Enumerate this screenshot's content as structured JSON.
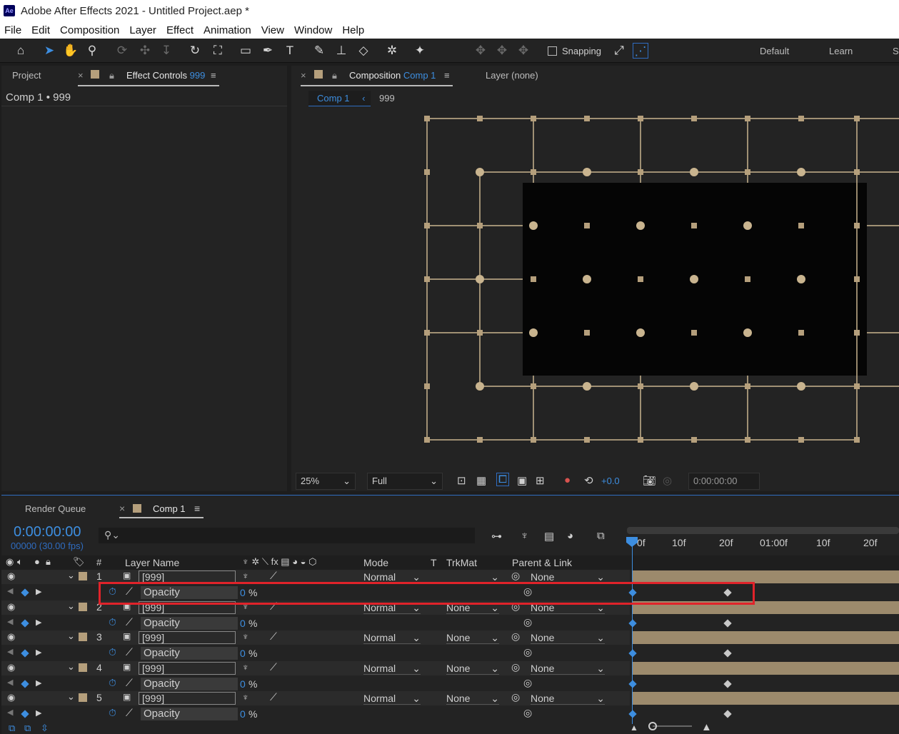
{
  "window": {
    "title": "Adobe After Effects 2021 - Untitled Project.aep *",
    "logo": "Ae"
  },
  "menu": [
    "File",
    "Edit",
    "Composition",
    "Layer",
    "Effect",
    "Animation",
    "View",
    "Window",
    "Help"
  ],
  "toolbar": {
    "snapping_label": "Snapping",
    "workspaces": [
      "Default",
      "Learn",
      "St"
    ]
  },
  "left_panel": {
    "tab_project": "Project",
    "tab_effect_controls": "Effect Controls",
    "effect_controls_target": "999",
    "breadcrumb": "Comp 1 • 999"
  },
  "comp_panel": {
    "tab_label": "Composition",
    "tab_comp_name": "Comp 1",
    "layer_tab": "Layer (none)",
    "nav_current": "Comp 1",
    "nav_child": "999",
    "zoom": "25%",
    "resolution": "Full",
    "exposure": "+0.0",
    "timecode": "0:00:00:00"
  },
  "timeline": {
    "tab_render_queue": "Render Queue",
    "tab_comp": "Comp 1",
    "current_time": "0:00:00:00",
    "frame_info": "00000 (30.00 fps)",
    "columns": {
      "num": "#",
      "layer_name": "Layer Name",
      "mode": "Mode",
      "t": "T",
      "trkmat": "TrkMat",
      "parent": "Parent & Link"
    },
    "ruler": [
      "0f",
      "10f",
      "20f",
      "01:00f",
      "10f",
      "20f"
    ],
    "layers": [
      {
        "num": "1",
        "name": "[999]",
        "mode": "Normal",
        "trkmat": "",
        "parent": "None",
        "prop": "Opacity",
        "prop_value": "0",
        "unit": "%"
      },
      {
        "num": "2",
        "name": "[999]",
        "mode": "Normal",
        "trkmat": "None",
        "parent": "None",
        "prop": "Opacity",
        "prop_value": "0",
        "unit": "%"
      },
      {
        "num": "3",
        "name": "[999]",
        "mode": "Normal",
        "trkmat": "None",
        "parent": "None",
        "prop": "Opacity",
        "prop_value": "0",
        "unit": "%"
      },
      {
        "num": "4",
        "name": "[999]",
        "mode": "Normal",
        "trkmat": "None",
        "parent": "None",
        "prop": "Opacity",
        "prop_value": "0",
        "unit": "%"
      },
      {
        "num": "5",
        "name": "[999]",
        "mode": "Normal",
        "trkmat": "None",
        "parent": "None",
        "prop": "Opacity",
        "prop_value": "0",
        "unit": "%"
      }
    ]
  },
  "colors": {
    "accent": "#3d8ee0",
    "highlight": "#e0232a",
    "label": "#b59f7c"
  }
}
